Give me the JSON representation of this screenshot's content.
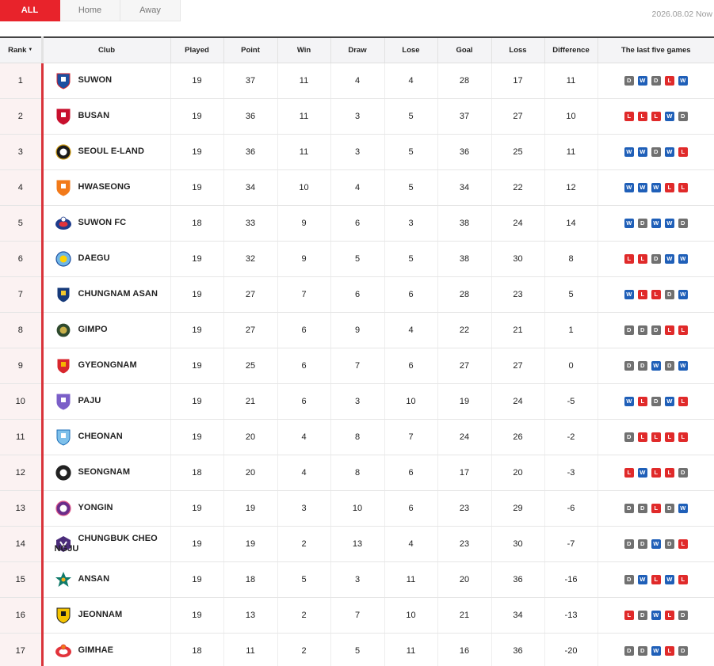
{
  "tabs": [
    "ALL",
    "Home",
    "Away"
  ],
  "active_tab": 0,
  "date_label": "2026.08.02 Now",
  "columns": [
    "Rank",
    "Club",
    "Played",
    "Point",
    "Win",
    "Draw",
    "Lose",
    "Goal",
    "Loss",
    "Difference",
    "The last five games"
  ],
  "sort_icon": "sort-down-icon",
  "result_colors": {
    "W": "#1f5fb8",
    "D": "#707070",
    "L": "#e02a2a"
  },
  "rows": [
    {
      "rank": "1",
      "club": "SUWON",
      "logo": "suwon-crest-icon",
      "played": "19",
      "point": "37",
      "win": "11",
      "draw": "4",
      "lose": "4",
      "goal": "28",
      "loss": "17",
      "diff": "11",
      "form": [
        "D",
        "W",
        "D",
        "L",
        "W"
      ]
    },
    {
      "rank": "2",
      "club": "BUSAN",
      "logo": "busan-crest-icon",
      "played": "19",
      "point": "36",
      "win": "11",
      "draw": "3",
      "lose": "5",
      "goal": "37",
      "loss": "27",
      "diff": "10",
      "form": [
        "L",
        "L",
        "L",
        "W",
        "D"
      ]
    },
    {
      "rank": "3",
      "club": "SEOUL E-LAND",
      "logo": "seoul-eland-crest-icon",
      "played": "19",
      "point": "36",
      "win": "11",
      "draw": "3",
      "lose": "5",
      "goal": "36",
      "loss": "25",
      "diff": "11",
      "form": [
        "W",
        "W",
        "D",
        "W",
        "L"
      ]
    },
    {
      "rank": "4",
      "club": "HWASEONG",
      "logo": "hwaseong-crest-icon",
      "played": "19",
      "point": "34",
      "win": "10",
      "draw": "4",
      "lose": "5",
      "goal": "34",
      "loss": "22",
      "diff": "12",
      "form": [
        "W",
        "W",
        "W",
        "L",
        "L"
      ]
    },
    {
      "rank": "5",
      "club": "SUWON FC",
      "logo": "suwon-fc-crest-icon",
      "played": "18",
      "point": "33",
      "win": "9",
      "draw": "6",
      "lose": "3",
      "goal": "38",
      "loss": "24",
      "diff": "14",
      "form": [
        "W",
        "D",
        "W",
        "W",
        "D"
      ]
    },
    {
      "rank": "6",
      "club": "DAEGU",
      "logo": "daegu-crest-icon",
      "played": "19",
      "point": "32",
      "win": "9",
      "draw": "5",
      "lose": "5",
      "goal": "38",
      "loss": "30",
      "diff": "8",
      "form": [
        "L",
        "L",
        "D",
        "W",
        "W"
      ]
    },
    {
      "rank": "7",
      "club": "CHUNGNAM ASAN",
      "logo": "chungnam-asan-crest-icon",
      "played": "19",
      "point": "27",
      "win": "7",
      "draw": "6",
      "lose": "6",
      "goal": "28",
      "loss": "23",
      "diff": "5",
      "form": [
        "W",
        "L",
        "L",
        "D",
        "W"
      ]
    },
    {
      "rank": "8",
      "club": "GIMPO",
      "logo": "gimpo-crest-icon",
      "played": "19",
      "point": "27",
      "win": "6",
      "draw": "9",
      "lose": "4",
      "goal": "22",
      "loss": "21",
      "diff": "1",
      "form": [
        "D",
        "D",
        "D",
        "L",
        "L"
      ]
    },
    {
      "rank": "9",
      "club": "GYEONGNAM",
      "logo": "gyeongnam-crest-icon",
      "played": "19",
      "point": "25",
      "win": "6",
      "draw": "7",
      "lose": "6",
      "goal": "27",
      "loss": "27",
      "diff": "0",
      "form": [
        "D",
        "D",
        "W",
        "D",
        "W"
      ]
    },
    {
      "rank": "10",
      "club": "PAJU",
      "logo": "paju-crest-icon",
      "played": "19",
      "point": "21",
      "win": "6",
      "draw": "3",
      "lose": "10",
      "goal": "19",
      "loss": "24",
      "diff": "-5",
      "form": [
        "W",
        "L",
        "D",
        "W",
        "L"
      ]
    },
    {
      "rank": "11",
      "club": "CHEONAN",
      "logo": "cheonan-crest-icon",
      "played": "19",
      "point": "20",
      "win": "4",
      "draw": "8",
      "lose": "7",
      "goal": "24",
      "loss": "26",
      "diff": "-2",
      "form": [
        "D",
        "L",
        "L",
        "L",
        "L"
      ]
    },
    {
      "rank": "12",
      "club": "SEONGNAM",
      "logo": "seongnam-crest-icon",
      "played": "18",
      "point": "20",
      "win": "4",
      "draw": "8",
      "lose": "6",
      "goal": "17",
      "loss": "20",
      "diff": "-3",
      "form": [
        "L",
        "W",
        "L",
        "L",
        "D"
      ]
    },
    {
      "rank": "13",
      "club": "YONGIN",
      "logo": "yongin-crest-icon",
      "played": "19",
      "point": "19",
      "win": "3",
      "draw": "10",
      "lose": "6",
      "goal": "23",
      "loss": "29",
      "diff": "-6",
      "form": [
        "D",
        "D",
        "L",
        "D",
        "W"
      ]
    },
    {
      "rank": "14",
      "club": "CHUNGBUK CHEONGJU",
      "club_line1": "CHUNGBUK CHEO",
      "club_line2": "NGJU",
      "logo": "chungbuk-cheongju-crest-icon",
      "played": "19",
      "point": "19",
      "win": "2",
      "draw": "13",
      "lose": "4",
      "goal": "23",
      "loss": "30",
      "diff": "-7",
      "form": [
        "D",
        "D",
        "W",
        "D",
        "L"
      ]
    },
    {
      "rank": "15",
      "club": "ANSAN",
      "logo": "ansan-crest-icon",
      "played": "19",
      "point": "18",
      "win": "5",
      "draw": "3",
      "lose": "11",
      "goal": "20",
      "loss": "36",
      "diff": "-16",
      "form": [
        "D",
        "W",
        "L",
        "W",
        "L"
      ]
    },
    {
      "rank": "16",
      "club": "JEONNAM",
      "logo": "jeonnam-crest-icon",
      "played": "19",
      "point": "13",
      "win": "2",
      "draw": "7",
      "lose": "10",
      "goal": "21",
      "loss": "34",
      "diff": "-13",
      "form": [
        "L",
        "D",
        "W",
        "L",
        "D"
      ]
    },
    {
      "rank": "17",
      "club": "GIMHAE",
      "logo": "gimhae-crest-icon",
      "played": "18",
      "point": "11",
      "win": "2",
      "draw": "5",
      "lose": "11",
      "goal": "16",
      "loss": "36",
      "diff": "-20",
      "form": [
        "D",
        "D",
        "W",
        "L",
        "D"
      ]
    }
  ]
}
